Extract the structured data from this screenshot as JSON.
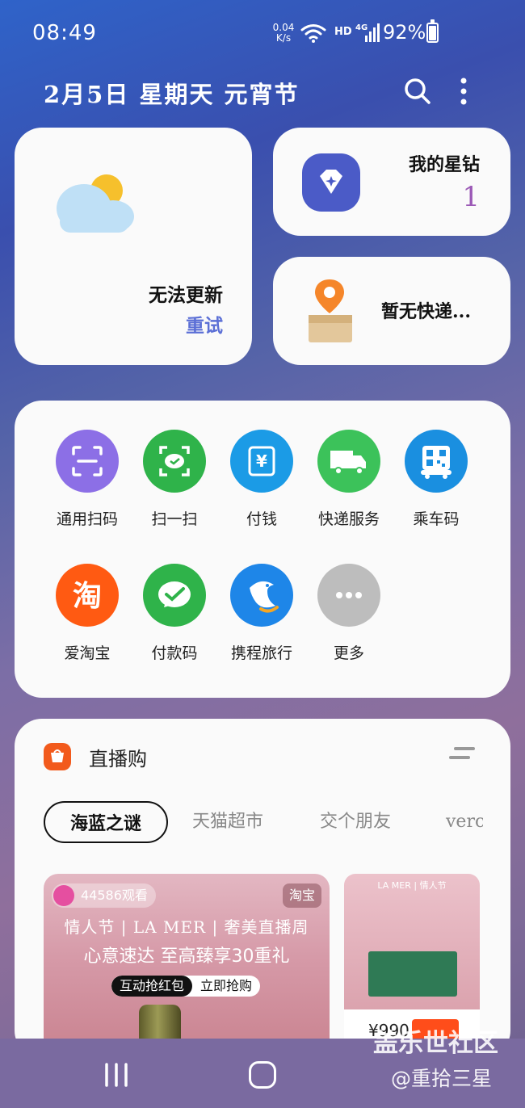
{
  "status_bar": {
    "time": "08:49",
    "net_speed_value": "0.04",
    "net_speed_unit": "K/s",
    "hd": "HD",
    "network": "4G",
    "battery": "92%",
    "battery_level": 0.92
  },
  "header": {
    "date": "2月5日 星期天 元宵节"
  },
  "weather": {
    "status": "无法更新",
    "retry": "重试",
    "icon": "partly-cloudy-icon"
  },
  "star": {
    "title": "我的星钻",
    "count": "1",
    "icon": "diamond-star-icon"
  },
  "express": {
    "text": "暂无快递...",
    "icon": "package-location-icon"
  },
  "shortcuts": [
    {
      "label": "通用扫码",
      "icon": "scan-frame-icon",
      "color": "#8c6fe6"
    },
    {
      "label": "扫一扫",
      "icon": "wechat-scan-icon",
      "color": "#2fb34a"
    },
    {
      "label": "付钱",
      "icon": "yuan-pay-icon",
      "color": "#1b9be6"
    },
    {
      "label": "快递服务",
      "icon": "truck-icon",
      "color": "#3cc25a"
    },
    {
      "label": "乘车码",
      "icon": "bus-qr-icon",
      "color": "#1a8fe0"
    },
    {
      "label": "爱淘宝",
      "icon": "taobao-icon",
      "color": "#ff5a12"
    },
    {
      "label": "付款码",
      "icon": "wechat-pay-icon",
      "color": "#2fb34a"
    },
    {
      "label": "携程旅行",
      "icon": "ctrip-dolphin-icon",
      "color": "#1e86e8"
    },
    {
      "label": "更多",
      "icon": "more-dots-icon",
      "color": "#bdbdbd"
    }
  ],
  "live": {
    "title": "直播购",
    "tabs": [
      "海蓝之谜",
      "天猫超市",
      "交个朋友",
      "verc"
    ],
    "main_promo": {
      "viewers": "44586观看",
      "platform": "淘宝",
      "line1": "情人节 | LA MER | 奢美直播周",
      "line2": "心意速达 至高臻享30重礼",
      "button_a": "互动抢红包",
      "button_b": "立即抢购"
    },
    "side_promo": {
      "header": "LA MER | 情人节",
      "price": "¥990"
    }
  },
  "watermark": {
    "line1": "盖乐世社区",
    "line2": "@重拾三星"
  }
}
